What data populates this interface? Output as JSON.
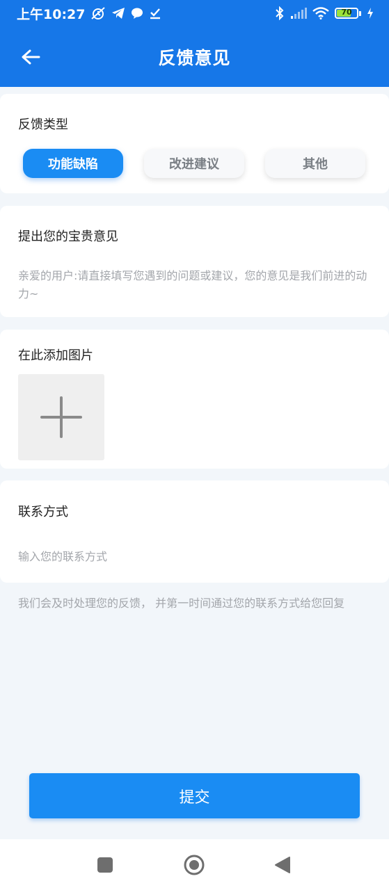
{
  "status_bar": {
    "time": "上午10:27",
    "battery_level": 70,
    "battery_label": "70"
  },
  "app_bar": {
    "title": "反馈意见"
  },
  "feedback_type": {
    "title": "反馈类型",
    "options": [
      "功能缺陷",
      "改进建议",
      "其他"
    ],
    "selected_index": 0
  },
  "opinion": {
    "title": "提出您的宝贵意见",
    "value": "",
    "placeholder": "亲爱的用户:请直接填写您遇到的问题或建议，您的意见是我们前进的动力~"
  },
  "images": {
    "title": "在此添加图片"
  },
  "contact": {
    "title": "联系方式",
    "value": "",
    "placeholder": "输入您的联系方式"
  },
  "note": "我们会及时处理您的反馈， 并第一时间通过您的联系方式给您回复",
  "submit": {
    "label": "提交"
  },
  "colors": {
    "primary": "#1677e8",
    "button": "#1a8cf3",
    "background": "#f2f6fa",
    "placeholder": "#a3a6ab"
  },
  "icons": {
    "back": "arrow-left-icon",
    "add_image": "plus-icon",
    "nav_recent": "square-icon",
    "nav_home": "circle-icon",
    "nav_back": "triangle-icon"
  }
}
